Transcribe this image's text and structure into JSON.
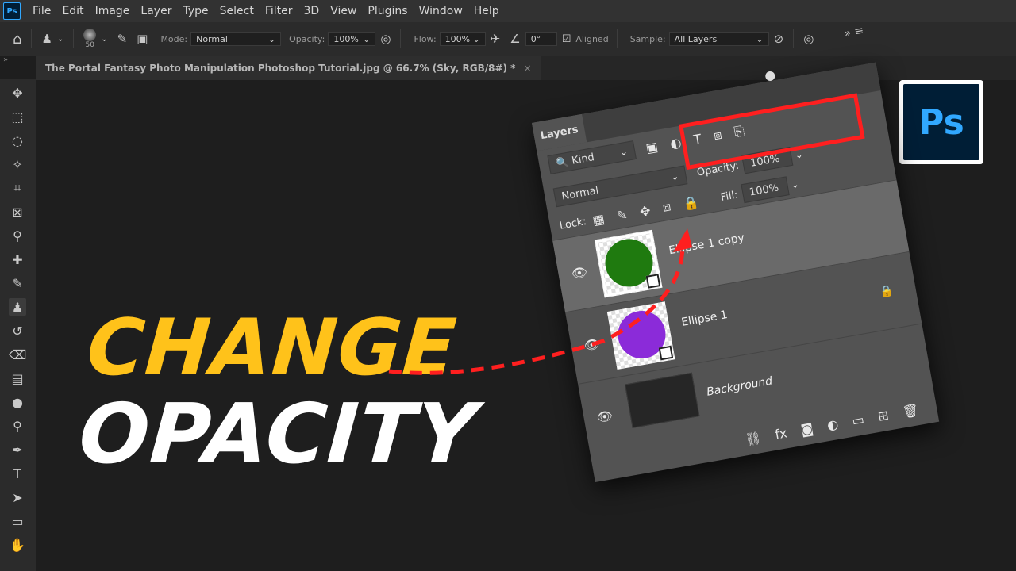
{
  "menubar": {
    "logo": "Ps",
    "items": [
      "File",
      "Edit",
      "Image",
      "Layer",
      "Type",
      "Select",
      "Filter",
      "3D",
      "View",
      "Plugins",
      "Window",
      "Help"
    ]
  },
  "options": {
    "brush_size": "50",
    "mode_label": "Mode:",
    "mode_value": "Normal",
    "opacity_label": "Opacity:",
    "opacity_value": "100%",
    "flow_label": "Flow:",
    "flow_value": "100%",
    "angle_value": "0°",
    "aligned_label": "Aligned",
    "sample_label": "Sample:",
    "sample_value": "All Layers"
  },
  "document": {
    "tab_title": "The Portal Fantasy Photo Manipulation Photoshop Tutorial.jpg @ 66.7% (Sky, RGB/8#) *",
    "close": "×"
  },
  "headline": {
    "line1": "CHANGE",
    "line2": "OPACITY"
  },
  "badge": {
    "text": "Ps"
  },
  "layers_panel": {
    "tab_label": "Layers",
    "filter_kind": "Kind",
    "blend_mode": "Normal",
    "opacity_label": "Opacity:",
    "opacity_value": "100%",
    "lock_label": "Lock:",
    "fill_label": "Fill:",
    "fill_value": "100%",
    "layers": [
      {
        "name": "Ellipse 1 copy",
        "color": "#1f7a0f",
        "selected": true
      },
      {
        "name": "Ellipse 1",
        "color": "#8b2bd9",
        "selected": false
      },
      {
        "name": "Background",
        "locked": true
      }
    ]
  },
  "colors": {
    "headline_yellow": "#ffc21a",
    "highlight_red": "#ff1f1f",
    "ps_blue": "#31a8ff",
    "ps_navy": "#001e36"
  }
}
